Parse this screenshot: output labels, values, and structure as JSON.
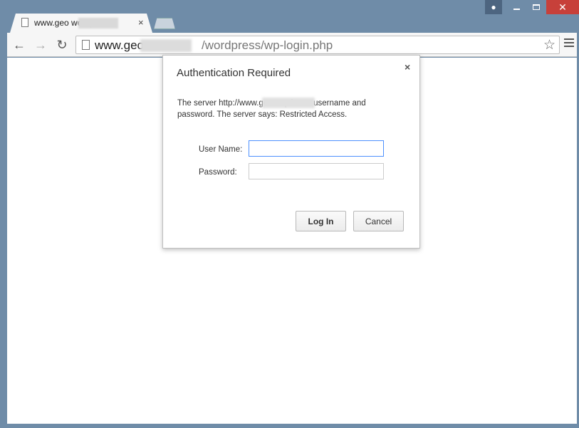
{
  "window": {
    "close_glyph": "✕"
  },
  "tab": {
    "title": "www.geo            wordp",
    "close_glyph": "×"
  },
  "toolbar": {
    "back_glyph": "←",
    "forward_glyph": "→",
    "reload_glyph": "↻",
    "star_glyph": "☆",
    "url_host": "www.geo",
    "url_path": "/wordpress/wp-login.php"
  },
  "dialog": {
    "title": "Authentication Required",
    "close_glyph": "×",
    "message": "The server http://www.geo                 requires a username and password. The server says: Restricted Access.",
    "username_label": "User Name:",
    "password_label": "Password:",
    "username_value": "",
    "password_value": "",
    "login_label": "Log In",
    "cancel_label": "Cancel"
  },
  "icons": [
    "user-icon",
    "minimize-icon",
    "maximize-icon",
    "close-icon",
    "page-icon",
    "back-arrow-icon",
    "forward-arrow-icon",
    "reload-icon",
    "star-icon",
    "menu-icon"
  ],
  "colors": {
    "chrome": "#6f8ca8",
    "close_button": "#c7403a",
    "focus_border": "#4d90fe"
  }
}
